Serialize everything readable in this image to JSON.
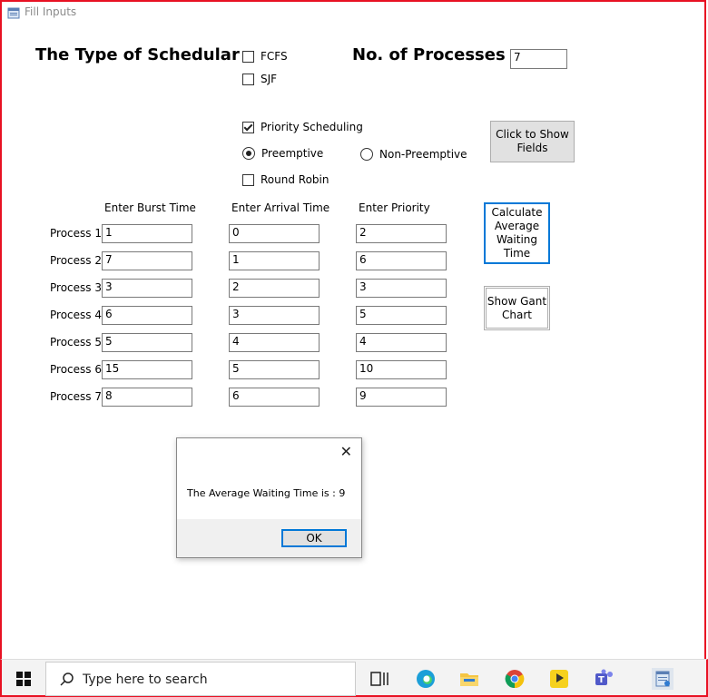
{
  "window": {
    "title": "Fill Inputs"
  },
  "form": {
    "schedular_label": "The Type of Schedular :",
    "processes_label": "No. of Processes :",
    "processes_value": "7",
    "options": {
      "fcfs": "FCFS",
      "sjf": "SJF",
      "priority": "Priority Scheduling",
      "preemptive": "Preemptive",
      "non_preemptive": "Non-Preemptive",
      "round_robin": "Round Robin"
    },
    "show_fields_button": "Click to Show Fields",
    "calc_button": "Calculate Average Waiting Time",
    "gantt_button": "Show Gant Chart",
    "columns": [
      "Enter Burst Time",
      "Enter Arrival Time",
      "Enter Priority"
    ],
    "processes": [
      {
        "label": "Process 1",
        "burst": "1",
        "arrival": "0",
        "priority": "2"
      },
      {
        "label": "Process 2",
        "burst": "7",
        "arrival": "1",
        "priority": "6"
      },
      {
        "label": "Process 3",
        "burst": "3",
        "arrival": "2",
        "priority": "3"
      },
      {
        "label": "Process 4",
        "burst": "6",
        "arrival": "3",
        "priority": "5"
      },
      {
        "label": "Process 5",
        "burst": "5",
        "arrival": "4",
        "priority": "4"
      },
      {
        "label": "Process 6",
        "burst": "15",
        "arrival": "5",
        "priority": "10"
      },
      {
        "label": "Process 7",
        "burst": "8",
        "arrival": "6",
        "priority": "9"
      }
    ]
  },
  "dialog": {
    "message": "The Average Waiting Time is : 9",
    "ok": "OK",
    "close": "✕"
  },
  "taskbar": {
    "search_placeholder": "Type here to search"
  }
}
